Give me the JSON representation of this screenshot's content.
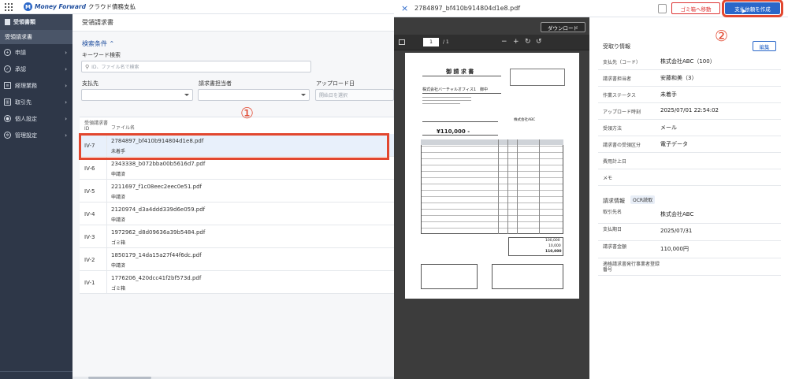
{
  "app": {
    "logo_mark": "M",
    "brand": "Money Forward",
    "service": "クラウド債務支払"
  },
  "sidebar": {
    "section": "受領書類",
    "active": "受領請求書",
    "items": [
      {
        "label": "申請",
        "icon": "plus-circle-icon"
      },
      {
        "label": "承認",
        "icon": "check-circle-icon"
      },
      {
        "label": "経理業務",
        "icon": "document-icon"
      },
      {
        "label": "取引先",
        "icon": "building-icon"
      },
      {
        "label": "個人設定",
        "icon": "person-icon"
      },
      {
        "label": "管理設定",
        "icon": "gear-icon"
      }
    ]
  },
  "main": {
    "title": "受領請求書",
    "filter": {
      "toggle": "検索条件",
      "keyword_label": "キーワード検索",
      "keyword_placeholder": "ID、ファイル名で検索",
      "payee_label": "支払先",
      "owner_label": "請求書担当者",
      "upload_label": "アップロード日",
      "upload_placeholder": "開始日を選択"
    },
    "table": {
      "col_id": "受領請求書ID",
      "col_file": "ファイル名",
      "rows": [
        {
          "id": "IV-7",
          "file": "2784897_bf410b914804d1e8.pdf",
          "status": "未着手",
          "selected": true
        },
        {
          "id": "IV-6",
          "file": "2343338_b072bba00b5616d7.pdf",
          "status": "申請済"
        },
        {
          "id": "IV-5",
          "file": "2211697_f1c08eec2eec0e51.pdf",
          "status": "申請済"
        },
        {
          "id": "IV-4",
          "file": "2120974_d3a4ddd339d6e059.pdf",
          "status": "申請済"
        },
        {
          "id": "IV-3",
          "file": "1972962_d8d09636a39b5484.pdf",
          "status": "ゴミ箱"
        },
        {
          "id": "IV-2",
          "file": "1850179_14da15a27f44f6dc.pdf",
          "status": "申請済"
        },
        {
          "id": "IV-1",
          "file": "1776206_420dcc41f2bf573d.pdf",
          "status": "ゴミ箱"
        }
      ]
    }
  },
  "callouts": {
    "one": "①",
    "two": "②"
  },
  "panel": {
    "close": "×",
    "filename": "2784897_bf410b914804d1e8.pdf",
    "trash_button": "ゴミ箱へ移動",
    "create_button": "支払依頼を作成",
    "download_button": "ダウンロード",
    "page_current": "1",
    "page_total": "/ 1",
    "receipt_section": "受取り情報",
    "edit_button": "編集",
    "receipt_rows": [
      {
        "k": "支払先（コード）",
        "v": "株式会社ABC（100）"
      },
      {
        "k": "請求書担当者",
        "v": "安藤和美（3）"
      },
      {
        "k": "作業ステータス",
        "v": "未着手"
      },
      {
        "k": "アップロード時刻",
        "v": "2025/07/01 22:54:02"
      },
      {
        "k": "受領方法",
        "v": "メール"
      },
      {
        "k": "請求書の受領区分",
        "v": "電子データ"
      },
      {
        "k": "費用計上日",
        "v": ""
      },
      {
        "k": "メモ",
        "v": ""
      }
    ],
    "invoice_section": "請求情報",
    "ocr_badge": "OCR読取",
    "invoice_rows": [
      {
        "k": "取引先名",
        "v": "株式会社ABC"
      },
      {
        "k": "支払期日",
        "v": "2025/07/31"
      },
      {
        "k": "請求書金額",
        "v": "110,000円"
      },
      {
        "k": "適格請求書発行事業者登録番号",
        "v": ""
      }
    ]
  },
  "doc": {
    "title": "御 請 求 書",
    "recipient": "株式会社バーチャルオフィス1　御中",
    "amount": "¥110,000 -",
    "subtotal": "100,000",
    "tax": "10,000",
    "total": "110,000",
    "company": "株式会社ABC"
  },
  "colors": {
    "accent": "#2a67c9",
    "highlight": "#e2472f",
    "sidebar": "#2e3748"
  }
}
